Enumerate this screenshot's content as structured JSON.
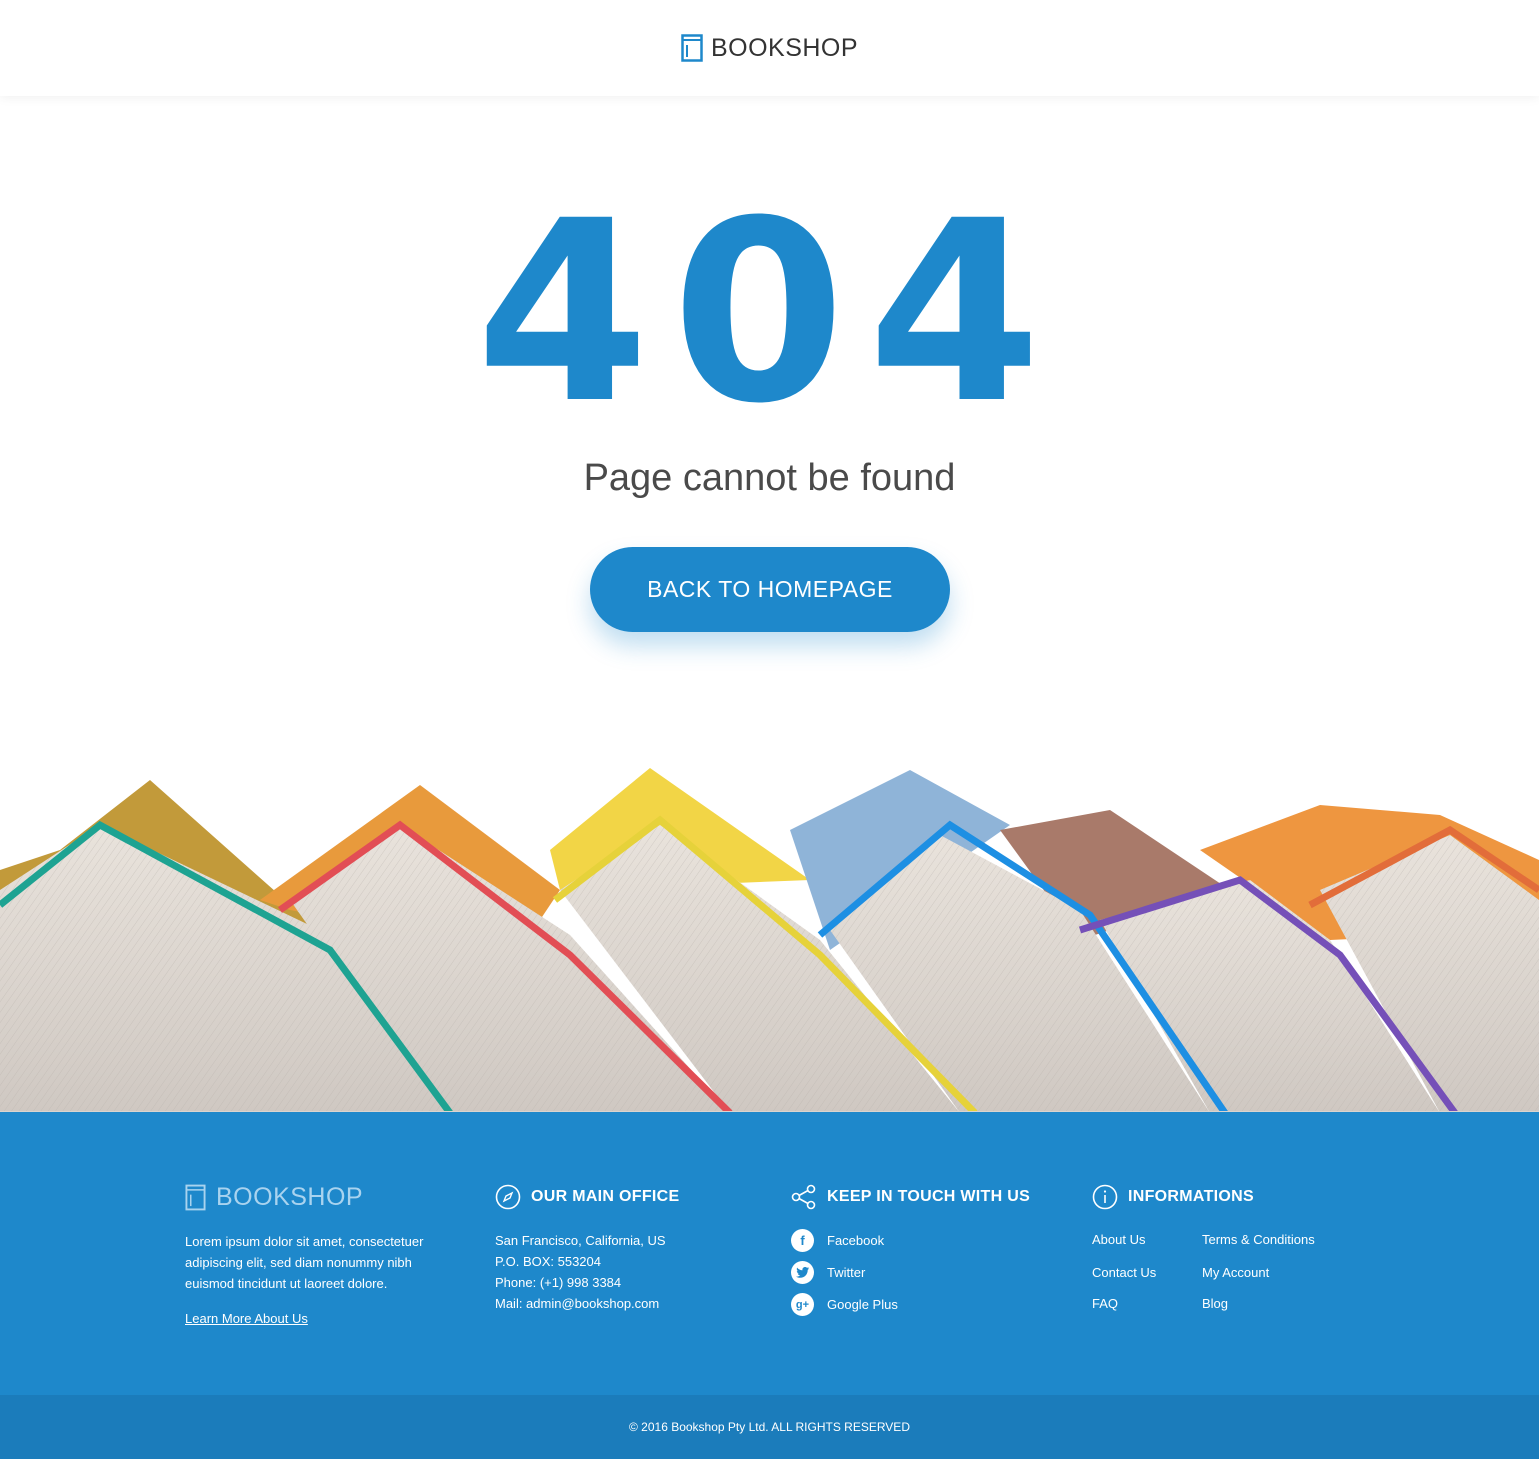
{
  "brand": {
    "name": "BOOKSHOP",
    "icon": "book-icon"
  },
  "colors": {
    "accent": "#1e88cb",
    "footer_bar": "#1b7cbb",
    "text": "#4a4a4a"
  },
  "error": {
    "code": "404",
    "message": "Page cannot be found",
    "button_label": "BACK TO HOMEPAGE"
  },
  "footer": {
    "about": {
      "brand": "BOOKSHOP",
      "text": "Lorem ipsum dolor sit amet, consectetuer adipiscing elit, sed diam nonummy nibh euismod tincidunt ut laoreet dolore.",
      "link": "Learn More About Us"
    },
    "office": {
      "title": "OUR MAIN OFFICE",
      "icon": "compass-icon",
      "lines": [
        "San Francisco, California, US",
        "P.O. BOX: 553204",
        "Phone: (+1) 998 3384",
        "Mail: admin@bookshop.com"
      ]
    },
    "social": {
      "title": "KEEP IN TOUCH WITH US",
      "icon": "share-icon",
      "items": [
        {
          "label": "Facebook",
          "icon": "facebook-icon"
        },
        {
          "label": "Twitter",
          "icon": "twitter-icon"
        },
        {
          "label": "Google Plus",
          "icon": "google-plus-icon"
        }
      ]
    },
    "info": {
      "title": "INFORMATIONS",
      "icon": "info-icon",
      "links": [
        "About Us",
        "Terms & Conditions",
        "Contact Us",
        "My Account",
        "FAQ",
        "Blog"
      ]
    },
    "copyright": "© 2016 Bookshop Pty Ltd. ALL RIGHTS RESERVED"
  }
}
